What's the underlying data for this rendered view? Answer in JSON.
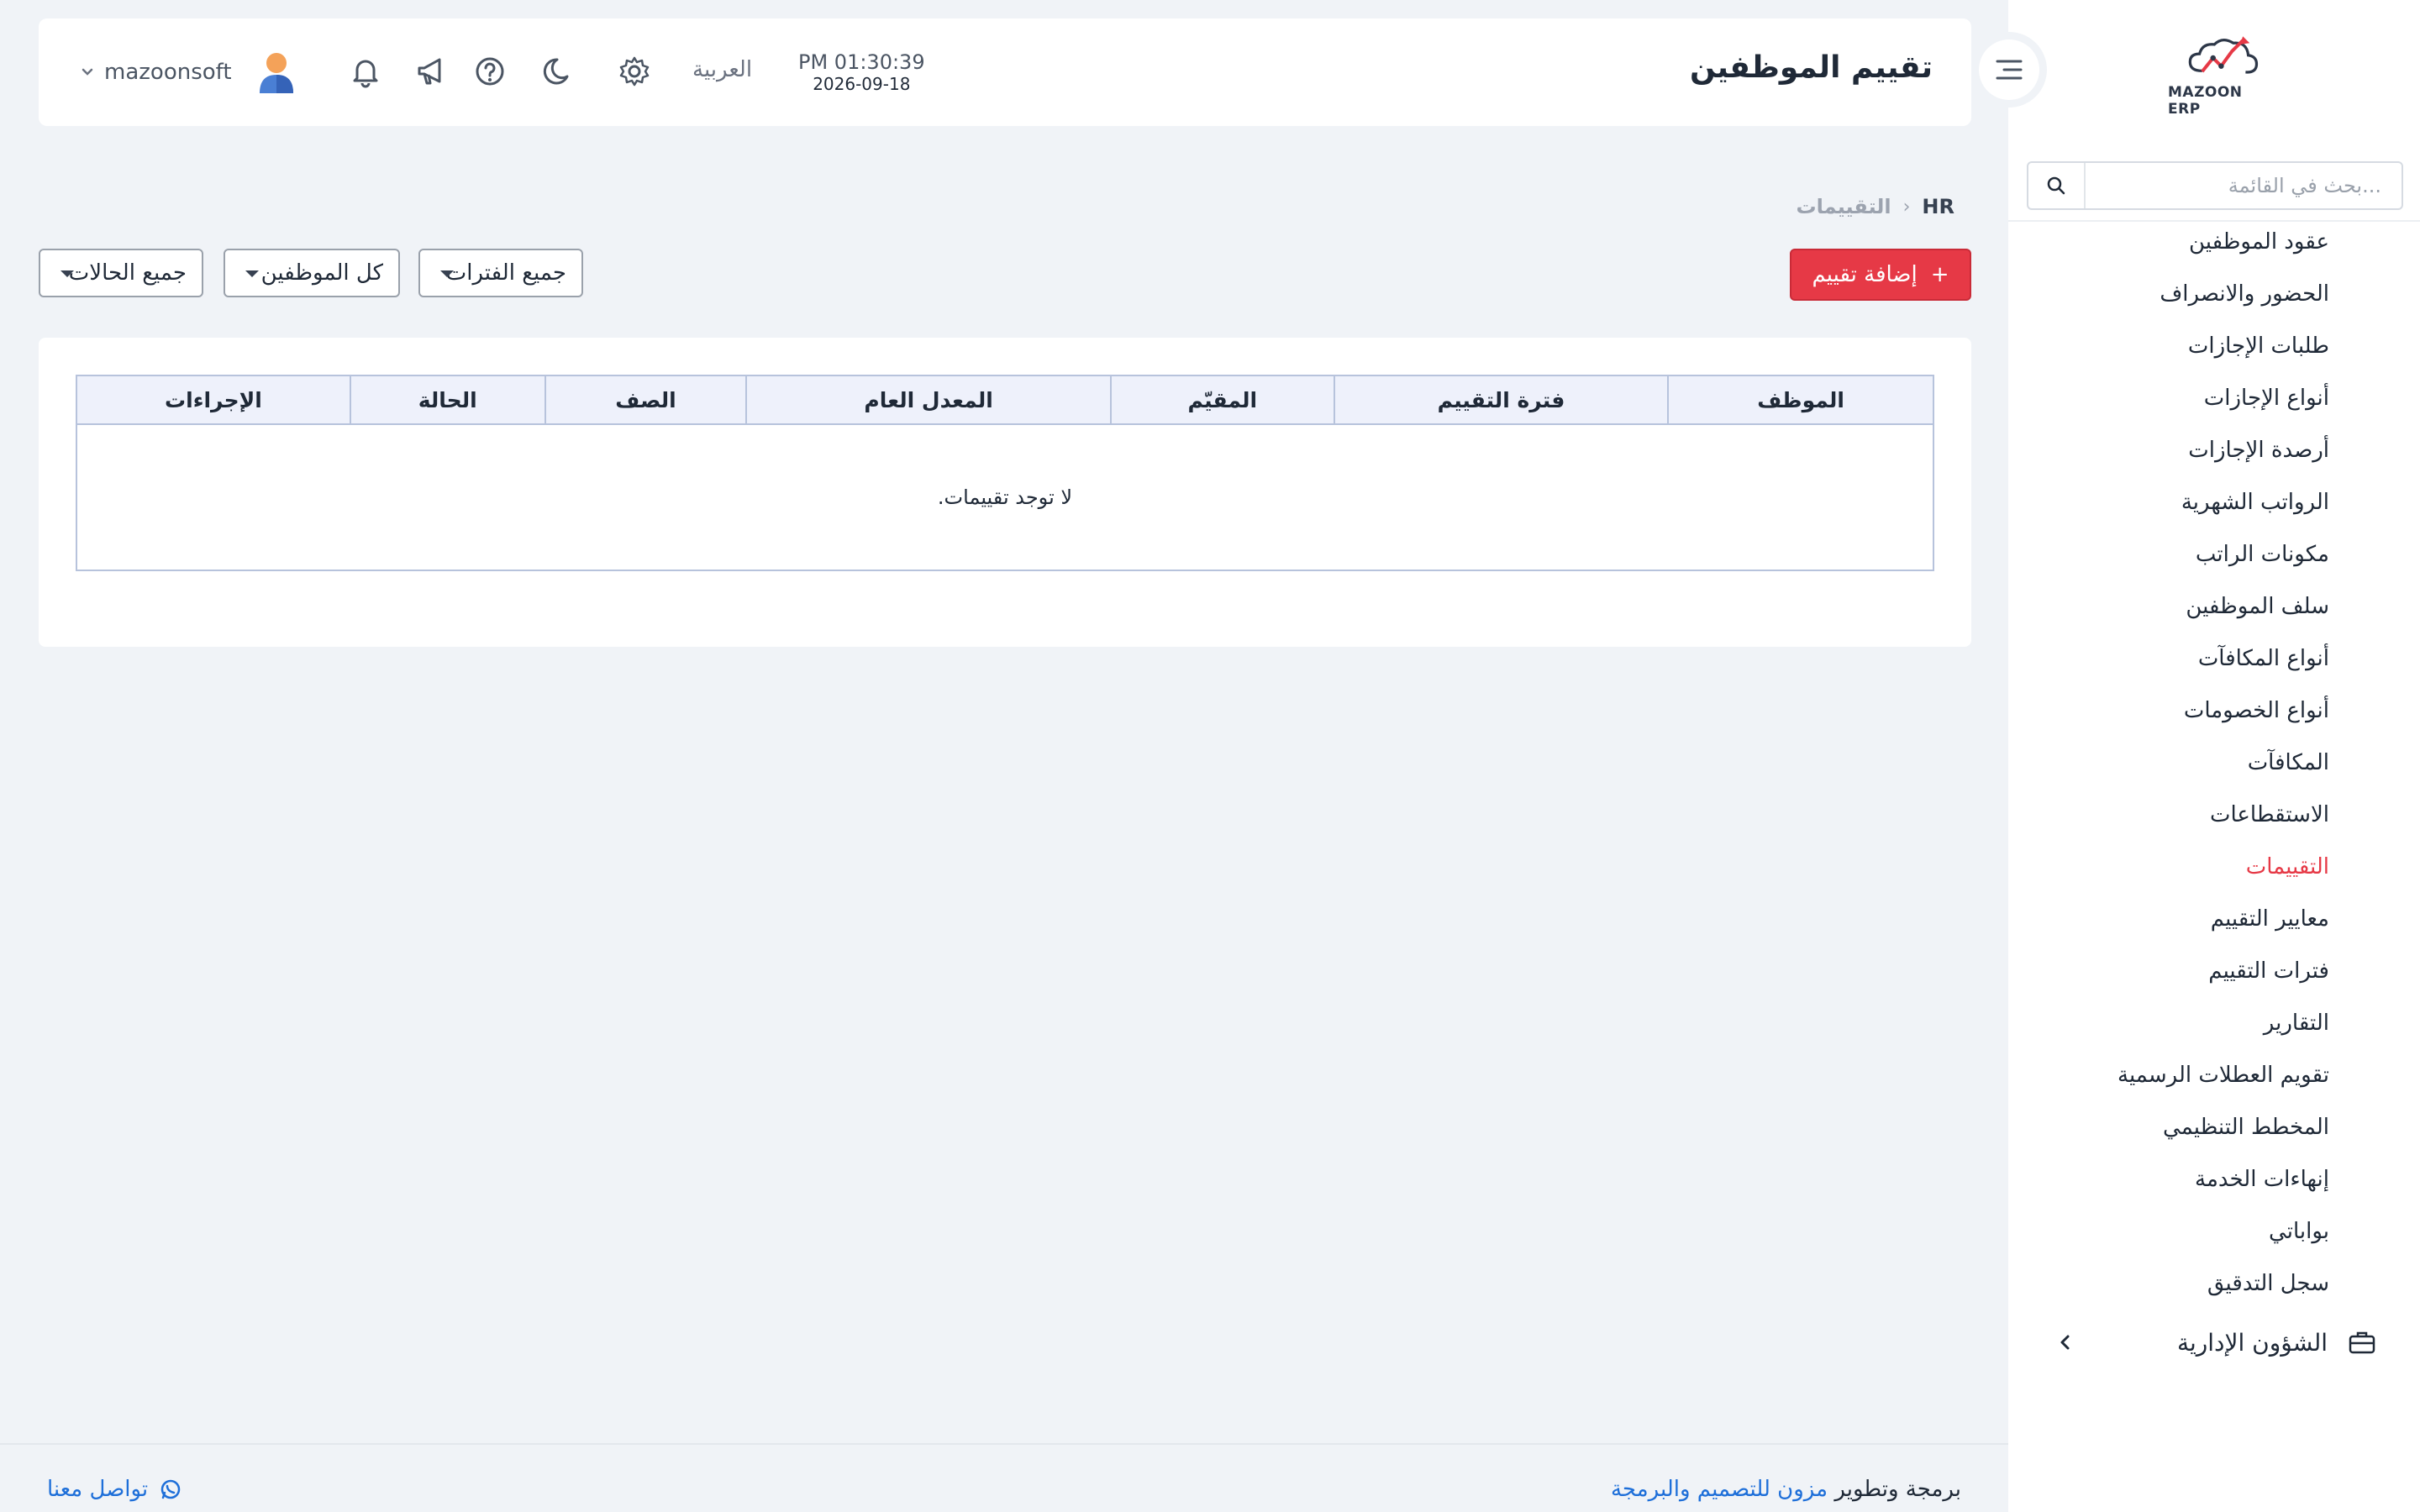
{
  "app": {
    "logo_text": "MAZOON ERP",
    "accent_color": "#e63946",
    "link_color": "#1e6fd9"
  },
  "header": {
    "title": "تقييم الموظفين",
    "time": "PM 01:30:39",
    "date": "2026-09-18",
    "language": "العربية",
    "username": "mazoonsoft",
    "icons": [
      "settings-icon",
      "moon-icon",
      "help-icon",
      "megaphone-icon",
      "bell-icon",
      "avatar"
    ]
  },
  "sidebar": {
    "search_placeholder": "بحث في القائمة...",
    "items": [
      {
        "label": "عقود الموظفين"
      },
      {
        "label": "الحضور والانصراف"
      },
      {
        "label": "طلبات الإجازات"
      },
      {
        "label": "أنواع الإجازات"
      },
      {
        "label": "أرصدة الإجازات"
      },
      {
        "label": "الرواتب الشهرية"
      },
      {
        "label": "مكونات الراتب"
      },
      {
        "label": "سلف الموظفين"
      },
      {
        "label": "أنواع المكافآت"
      },
      {
        "label": "أنواع الخصومات"
      },
      {
        "label": "المكافآت"
      },
      {
        "label": "الاستقطاعات"
      },
      {
        "label": "التقييمات",
        "active": true
      },
      {
        "label": "معايير التقييم"
      },
      {
        "label": "فترات التقييم"
      },
      {
        "label": "التقارير"
      },
      {
        "label": "تقويم العطلات الرسمية"
      },
      {
        "label": "المخطط التنظيمي"
      },
      {
        "label": "إنهاءات الخدمة"
      },
      {
        "label": "بواباتي"
      },
      {
        "label": "سجل التدقيق"
      }
    ],
    "group": {
      "label": "الشؤون الإدارية"
    }
  },
  "breadcrumb": {
    "root": "HR",
    "current": "التقييمات"
  },
  "toolbar": {
    "add_label": "إضافة تقييم",
    "add_icon": "+",
    "filters": {
      "periods": "جميع الفترات",
      "employees": "كل الموظفين",
      "statuses": "جميع الحالات"
    }
  },
  "table": {
    "columns": [
      "الموظف",
      "فترة التقييم",
      "المقيّم",
      "المعدل العام",
      "الصف",
      "الحالة",
      "الإجراءات"
    ],
    "empty_message": "لا توجد تقييمات."
  },
  "footer": {
    "credit_prefix": "برمجة وتطوير",
    "credit_company": "مزون للتصميم والبرمجة",
    "contact": "تواصل معنا"
  }
}
